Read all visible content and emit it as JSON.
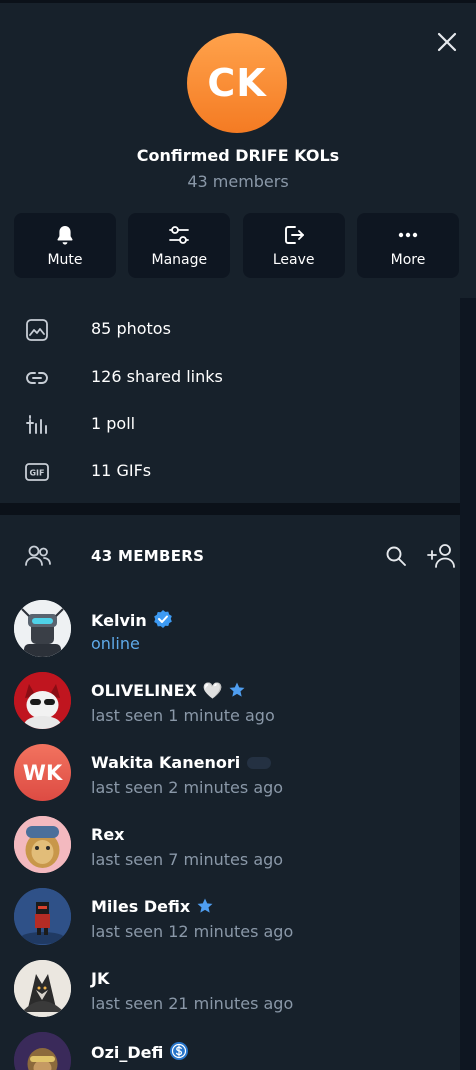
{
  "header": {
    "avatar_initials": "CK",
    "title": "Confirmed DRIFE KOLs",
    "subtitle": "43 members",
    "actions": [
      {
        "label": "Mute",
        "icon": "bell-icon"
      },
      {
        "label": "Manage",
        "icon": "sliders-icon"
      },
      {
        "label": "Leave",
        "icon": "leave-icon"
      },
      {
        "label": "More",
        "icon": "more-icon"
      }
    ]
  },
  "media": [
    {
      "label": "85 photos",
      "icon": "photo-icon"
    },
    {
      "label": "126 shared links",
      "icon": "link-icon"
    },
    {
      "label": "1 poll",
      "icon": "poll-icon"
    },
    {
      "label": "11 GIFs",
      "icon": "gif-icon"
    }
  ],
  "gif_icon_text": "GIF",
  "members": {
    "title": "43 MEMBERS",
    "list": [
      {
        "name": "Kelvin",
        "status": "online",
        "badge": "verified-badge-icon"
      },
      {
        "name": "OLIVELINEX 🤍",
        "status": "last seen 1 minute ago",
        "badge": "star-badge-icon"
      },
      {
        "name": "Wakita Kanenori",
        "status": "last seen 2 minutes ago",
        "badge": "custom-emoji-icon",
        "initials": "WK"
      },
      {
        "name": "Rex",
        "status": "last seen 7 minutes ago",
        "badge": ""
      },
      {
        "name": "Miles Defix",
        "status": "last seen 12 minutes ago",
        "badge": "star-badge-icon"
      },
      {
        "name": "JK",
        "status": "last seen 21 minutes ago",
        "badge": ""
      },
      {
        "name": "Ozi_Defi",
        "status": "",
        "badge": "dollar-badge-icon"
      }
    ]
  },
  "colors": {
    "accent": "#5ea9e8",
    "header_bg": "#17212b",
    "page_bg": "#0e1621",
    "avatar_orange": "#f58a2f",
    "avatar_red": "#e55a4e"
  }
}
